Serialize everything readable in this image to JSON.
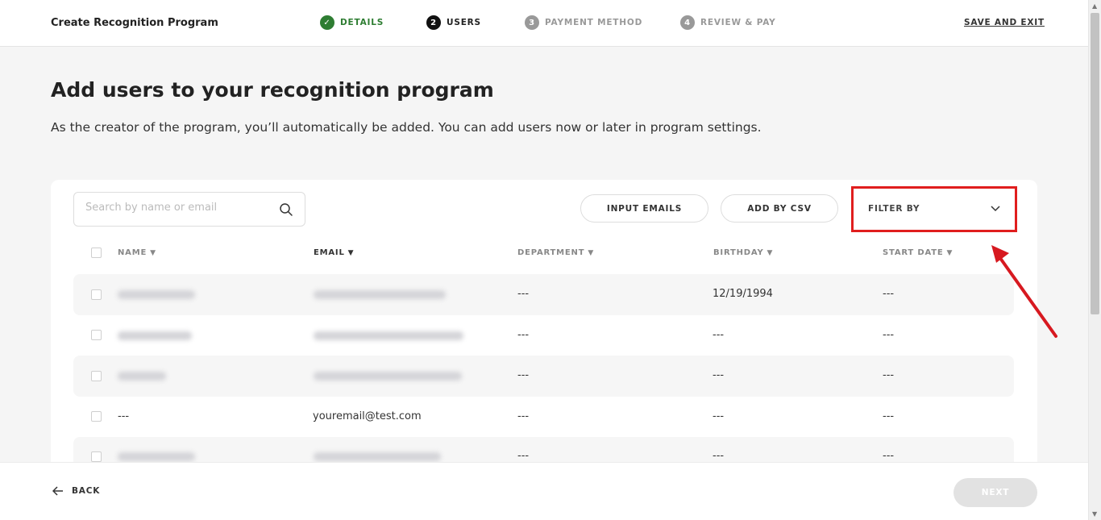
{
  "header": {
    "title": "Create Recognition Program",
    "steps": [
      {
        "label": "DETAILS",
        "marker": "✓",
        "state": "done"
      },
      {
        "label": "USERS",
        "marker": "2",
        "state": "active"
      },
      {
        "label": "PAYMENT METHOD",
        "marker": "3",
        "state": "pending"
      },
      {
        "label": "REVIEW & PAY",
        "marker": "4",
        "state": "pending"
      }
    ],
    "save_exit": "SAVE AND EXIT"
  },
  "page": {
    "title": "Add users to your recognition program",
    "subtitle": "As the creator of the program, you’ll automatically be added. You can add users now or later in program settings."
  },
  "toolbar": {
    "search_placeholder": "Search by name or email",
    "input_emails": "INPUT EMAILS",
    "add_by_csv": "ADD BY CSV",
    "filter_by": "FILTER BY"
  },
  "table": {
    "columns": [
      "NAME",
      "EMAIL",
      "DEPARTMENT",
      "BIRTHDAY",
      "START DATE"
    ],
    "rows": [
      {
        "name": "",
        "email": "",
        "department": "---",
        "birthday": "12/19/1994",
        "start_date": "---",
        "blurred": true
      },
      {
        "name": "",
        "email": "",
        "department": "---",
        "birthday": "---",
        "start_date": "---",
        "blurred": true
      },
      {
        "name": "",
        "email": "",
        "department": "---",
        "birthday": "---",
        "start_date": "---",
        "blurred": true
      },
      {
        "name": "---",
        "email": "youremail@test.com",
        "department": "---",
        "birthday": "---",
        "start_date": "---",
        "blurred": false
      },
      {
        "name": "",
        "email": "",
        "department": "---",
        "birthday": "---",
        "start_date": "---",
        "blurred": true
      }
    ]
  },
  "footer": {
    "back": "BACK",
    "next": "NEXT"
  },
  "colors": {
    "done_green": "#2e7d32",
    "highlight_red": "#e01e1e",
    "arrow_red": "#d71920"
  }
}
